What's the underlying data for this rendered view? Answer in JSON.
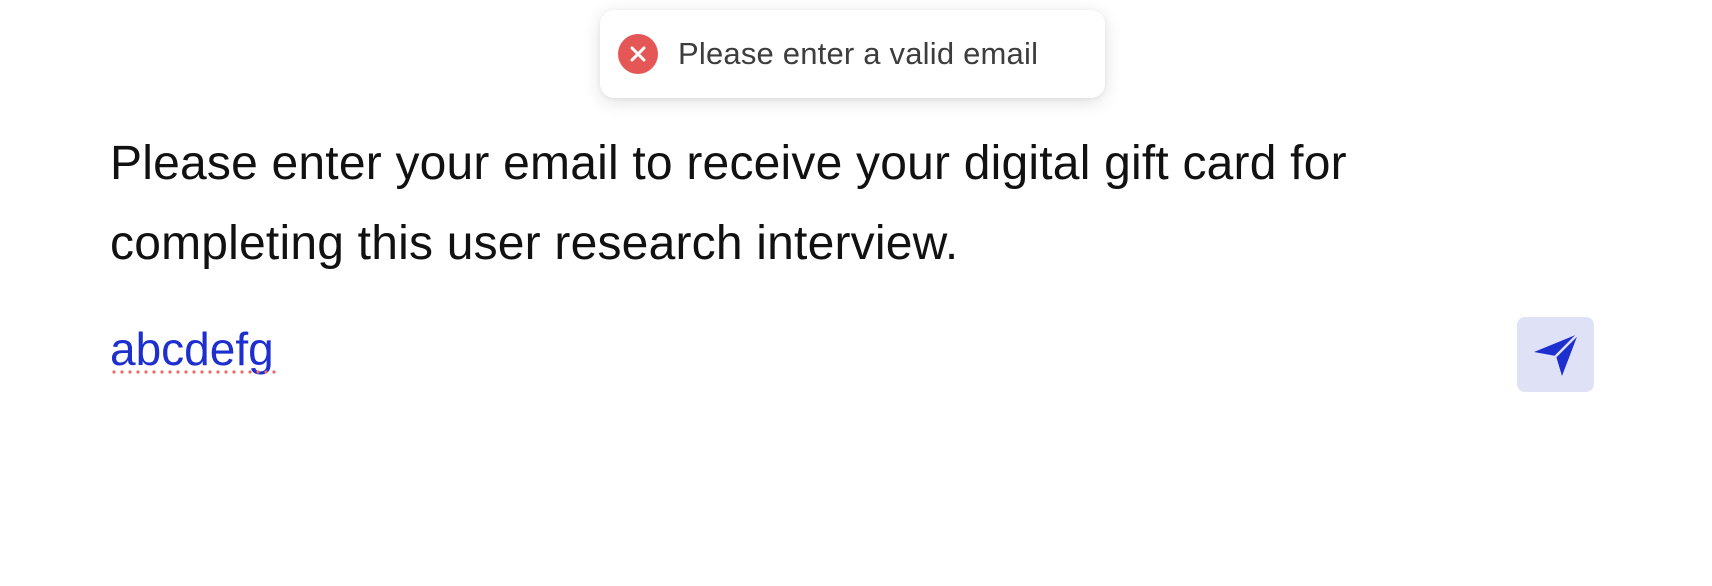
{
  "toast": {
    "message": "Please enter a valid email",
    "icon": "error-x-circle-icon",
    "icon_color": "#e55656"
  },
  "prompt": {
    "text": "Please enter your email to receive your digital gift card for completing this user research interview."
  },
  "email_input": {
    "value": "abcdefg",
    "text_color": "#1d2fcf"
  },
  "send_button": {
    "icon": "send-paper-plane-icon",
    "background": "#dfe2f6",
    "icon_color": "#1d2fcf"
  }
}
